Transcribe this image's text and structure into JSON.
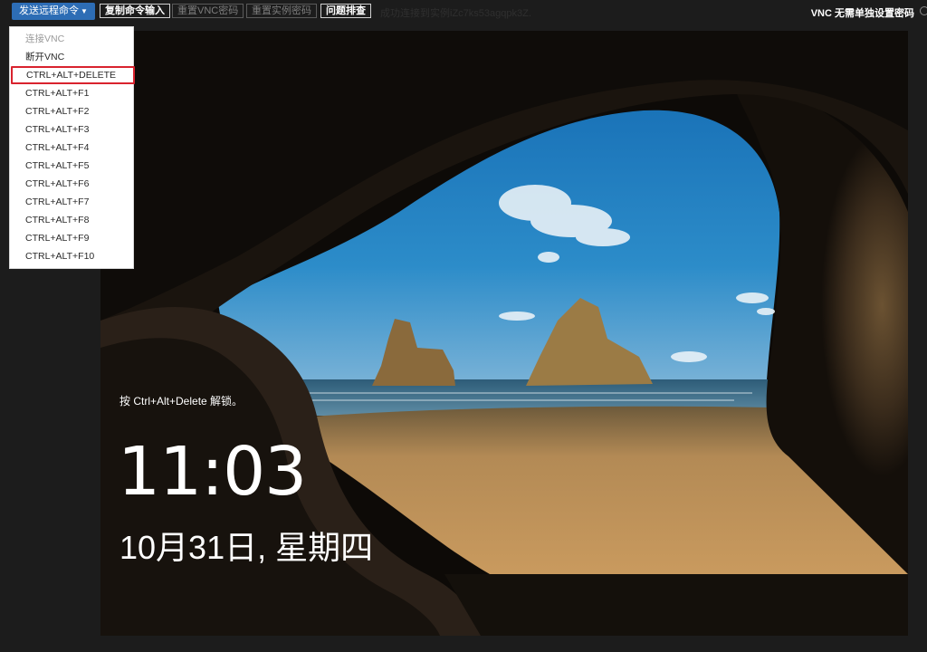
{
  "toolbar": {
    "send_remote_command": "发送远程命令",
    "copy_command_input": "复制命令输入",
    "reset_vnc_password": "重置VNC密码",
    "reset_instance_password": "重置实例密码",
    "troubleshoot": "问题排查",
    "status_text": "成功连接到实例iZc7ks53agqpk3Z.",
    "vnc_no_password": "VNC 无需单独设置密码"
  },
  "dropdown": {
    "items": [
      {
        "label": "连接VNC",
        "state": "disabled"
      },
      {
        "label": "断开VNC",
        "state": "normal"
      },
      {
        "label": "CTRL+ALT+DELETE",
        "state": "highlighted"
      },
      {
        "label": "CTRL+ALT+F1",
        "state": "normal"
      },
      {
        "label": "CTRL+ALT+F2",
        "state": "normal"
      },
      {
        "label": "CTRL+ALT+F3",
        "state": "normal"
      },
      {
        "label": "CTRL+ALT+F4",
        "state": "normal"
      },
      {
        "label": "CTRL+ALT+F5",
        "state": "normal"
      },
      {
        "label": "CTRL+ALT+F6",
        "state": "normal"
      },
      {
        "label": "CTRL+ALT+F7",
        "state": "normal"
      },
      {
        "label": "CTRL+ALT+F8",
        "state": "normal"
      },
      {
        "label": "CTRL+ALT+F9",
        "state": "normal"
      },
      {
        "label": "CTRL+ALT+F10",
        "state": "normal"
      }
    ]
  },
  "lockscreen": {
    "hint": "按 Ctrl+Alt+Delete 解锁。",
    "time": "11:03",
    "date": "10月31日, 星期四"
  },
  "icons": {
    "dropdown_caret": "caret-down-icon",
    "network": "network-icon",
    "status_circle": "circle-icon"
  },
  "colors": {
    "primary_button": "#2d6db5",
    "highlight_border": "#d9232e",
    "toolbar_bg": "#1c1c1c"
  }
}
